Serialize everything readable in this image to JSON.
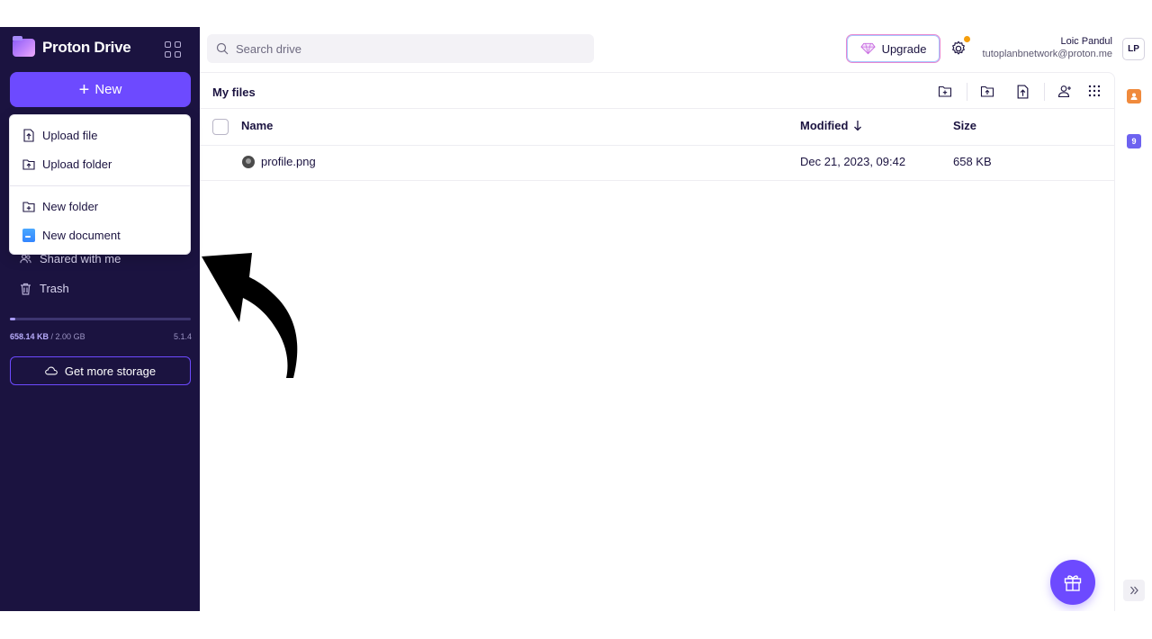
{
  "brand": {
    "name": "Proton Drive"
  },
  "sidebar": {
    "new_label": "New",
    "items": [
      {
        "label": "Shared with me",
        "icon": "shared-users-icon"
      },
      {
        "label": "Trash",
        "icon": "trash-icon"
      }
    ],
    "storage": {
      "used": "658.14 KB",
      "separator": " / ",
      "total": "2.00 GB",
      "fraction_used": 0.0003
    },
    "version": "5.1.4",
    "get_storage_label": "Get more storage"
  },
  "new_menu": {
    "items": [
      {
        "label": "Upload file",
        "icon": "upload-file-icon"
      },
      {
        "label": "Upload folder",
        "icon": "upload-folder-icon"
      },
      {
        "label": "New folder",
        "icon": "new-folder-icon"
      },
      {
        "label": "New document",
        "icon": "proton-docs-icon"
      }
    ]
  },
  "search": {
    "placeholder": "Search drive"
  },
  "header": {
    "upgrade_label": "Upgrade",
    "user_name": "Loic Pandul",
    "user_email": "tutoplanbnetwork@proton.me",
    "avatar_initials": "LP"
  },
  "main": {
    "title": "My files",
    "columns": {
      "name": "Name",
      "modified": "Modified",
      "size": "Size"
    },
    "rows": [
      {
        "name": "profile.png",
        "modified": "Dec 21, 2023, 09:42",
        "size": "658 KB"
      }
    ]
  },
  "rail": {
    "badge_count": "9"
  },
  "colors": {
    "sidebar_bg": "#1b1340",
    "accent": "#6d4aff",
    "upgrade_border": "#e887d0"
  }
}
